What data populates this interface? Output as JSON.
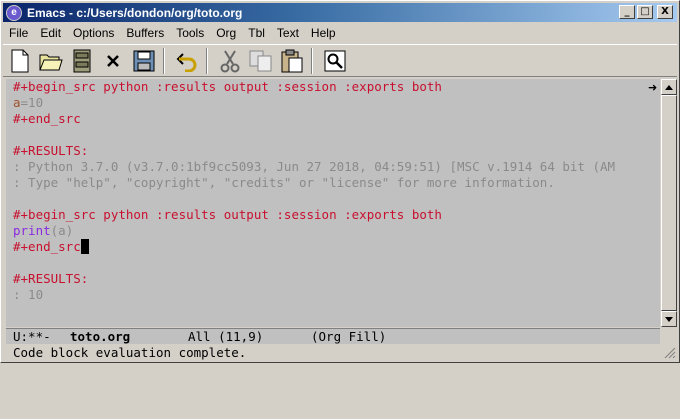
{
  "window": {
    "title": "Emacs - c:/Users/dondon/org/toto.org",
    "app_icon_glyph": "e"
  },
  "title_buttons": {
    "minimize": "_",
    "maximize": "□",
    "close": "X"
  },
  "menubar": [
    "File",
    "Edit",
    "Options",
    "Buffers",
    "Tools",
    "Org",
    "Tbl",
    "Text",
    "Help"
  ],
  "toolbar": {
    "buttons": [
      "new-file-icon",
      "open-folder-icon",
      "dired-icon",
      "kill-buffer-icon",
      "save-icon",
      "undo-icon",
      "cut-icon",
      "copy-icon",
      "paste-icon",
      "search-icon"
    ]
  },
  "buffer": {
    "line1": "#+begin_src python :results output :session :exports both",
    "line2_var": "a",
    "line2_rest": "=10",
    "line3": "#+end_src",
    "line5": "#+RESULTS:",
    "line6": ": Python 3.7.0 (v3.7.0:1bf9cc5093, Jun 27 2018, 04:59:51) [MSC v.1914 64 bit (AM",
    "line7": ": Type \"help\", \"copyright\", \"credits\" or \"license\" for more information.",
    "line9": "#+begin_src python :results output :session :exports both",
    "line10_fn": "print",
    "line10_rest": "(a)",
    "line11": "#+end_src",
    "line13": "#+RESULTS:",
    "line14": ": 10",
    "truncation_marker": "➜"
  },
  "modeline": {
    "status": "U:**-",
    "buffer_name": "toto.org",
    "position": "All (11,9)",
    "modes": "(Org Fill)"
  },
  "minibuffer": {
    "message": "Code block evaluation complete."
  },
  "colors": {
    "keyword": "#c8102e",
    "result": "#8a8a8a",
    "editor_bg": "#c0c0c0",
    "titlebar_start": "#0a246a",
    "titlebar_end": "#a6caf0"
  }
}
